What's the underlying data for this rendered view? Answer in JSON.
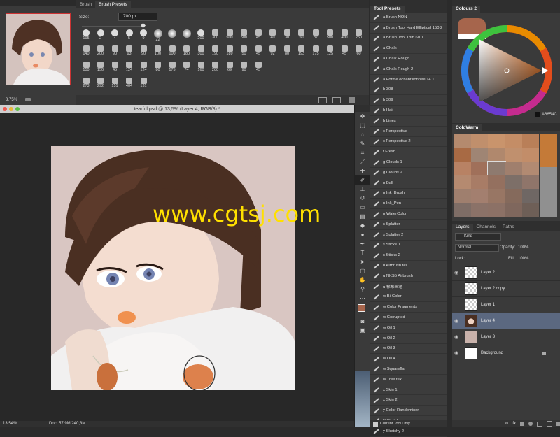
{
  "navigator": {
    "zoom": "3,75%"
  },
  "brush": {
    "tabs": [
      "Brush",
      "Brush Presets"
    ],
    "size_label": "Size:",
    "size_value": "700 px",
    "sizes_row1": [
      "195",
      "2",
      "4",
      "5",
      "9",
      "22",
      "",
      "",
      "200",
      "300",
      "500",
      "500",
      "45",
      "40",
      "30",
      "50",
      "87",
      "500",
      "400",
      "250"
    ],
    "sizes_row2": [
      "140",
      "200",
      "90",
      "93",
      "90",
      "100",
      "100",
      "180",
      "300",
      "190",
      "189",
      "50",
      "45",
      "92",
      "80",
      "193",
      "175",
      "125",
      "45",
      "60"
    ],
    "sizes_row3": [
      "150",
      "150",
      "45",
      "124",
      "124",
      "80",
      "175",
      "74",
      "160",
      "200",
      "69",
      "90",
      "45"
    ],
    "sizes_row4": [
      "273",
      "292",
      "151",
      "404",
      "131"
    ]
  },
  "document": {
    "title": "tearful.psd @ 13,5% (Layer 4, RGB/8) *",
    "status_zoom": "13,54%",
    "status_doc": "Doc: 57,9M/240,3M",
    "watermark": "www.cgtsj.com"
  },
  "tool_presets": {
    "title": "Tool Presets",
    "items": [
      "a Brush NON",
      "a Brush Tool Hard Elliptical 150 2",
      "a Brush Tool Thin 60 1",
      "a Chalk",
      "a Chalk Rough",
      "a Chalk Rough 2",
      "a Forme échantillonnée 14 1",
      "b 308",
      "b 309",
      "b Hair",
      "b Lines",
      "c Perspective",
      "c Perspective 2",
      "f Fresh",
      "g Clouds 1",
      "g Clouds 2",
      "n Ball",
      "n Ink_Brush",
      "n Ink_Pen",
      "n WaterColor",
      "s Splatter",
      "s Splatter 2",
      "s Sticks 1",
      "s Sticks 2",
      "u Airbrush tex",
      "u NKS5 Airbrush",
      "u 棉布画笔",
      "w Bi-Color",
      "w Color Fragments",
      "w Corrupted",
      "w Oil 1",
      "w Oil 2",
      "w Oil 3",
      "w Oil 4",
      "w Squareflat",
      "w Tree tex",
      "x Skin 1",
      "x Skin 2",
      "y Color Randomixer",
      "Y Sketchy",
      "y Sketchy 2"
    ],
    "current_only": "Current Tool Only"
  },
  "colour": {
    "title": "Colours 2",
    "hex": "A6654C",
    "fg": "#a6654c",
    "bg": "#ffffff"
  },
  "swatches": {
    "title": "ColdWarm",
    "colors": [
      "#b48a6e",
      "#c08f6c",
      "#c9946c",
      "#c48d66",
      "#b97f58",
      "#a86a44",
      "#9f8574",
      "#b0886d",
      "#c0906e",
      "#c28d69",
      "#b88264",
      "#a0705a",
      "#8e7a6f",
      "#a07f6d",
      "#b28a72",
      "#b58a70",
      "#a87c66",
      "#94705f",
      "#7d6f68",
      "#8f756a",
      "#9f7f6e",
      "#a37f6f",
      "#987664",
      "#856a5c",
      "#6f6764",
      "#7e6d66",
      "#8b7268",
      "#8c7166",
      "#7f675d",
      "#6e5f57"
    ]
  },
  "layers": {
    "tabs": [
      "Layers",
      "Channels",
      "Paths"
    ],
    "kind": "Kind",
    "blend": "Normal",
    "opacity_label": "Opacity:",
    "opacity": "100%",
    "lock_label": "Lock:",
    "fill_label": "Fill:",
    "fill": "100%",
    "list": [
      {
        "name": "Layer 2",
        "thumb": "checker"
      },
      {
        "name": "Layer 2 copy",
        "thumb": "checker"
      },
      {
        "name": "Layer 1",
        "thumb": "checker"
      },
      {
        "name": "Layer 4",
        "thumb": "portrait"
      },
      {
        "name": "Layer 3",
        "thumb": "#c9b2ab"
      },
      {
        "name": "Background",
        "thumb": "#ffffff"
      }
    ]
  }
}
